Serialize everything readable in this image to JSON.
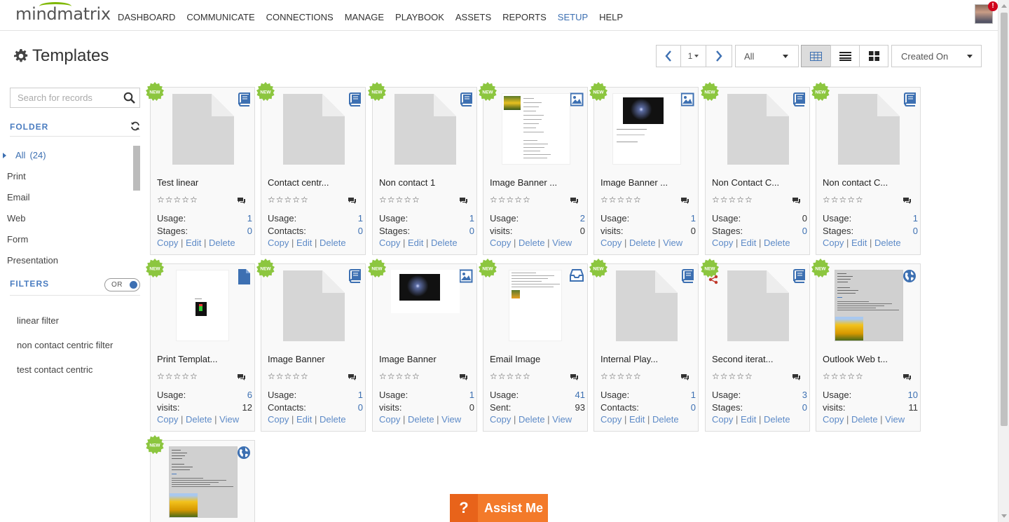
{
  "app": {
    "logo": "mindmatrix"
  },
  "nav": {
    "items": [
      "DASHBOARD",
      "COMMUNICATE",
      "CONNECTIONS",
      "MANAGE",
      "PLAYBOOK",
      "ASSETS",
      "REPORTS",
      "SETUP",
      "HELP"
    ],
    "active": "SETUP",
    "notification_badge": "!"
  },
  "page": {
    "title": "Templates",
    "title_icon": "gear-icon"
  },
  "toolbar": {
    "page_number": "1",
    "filter_value": "All",
    "sort_value": "Created On",
    "active_view": "grid"
  },
  "sidebar": {
    "search_placeholder": "Search for records",
    "folder_title": "FOLDER",
    "folders": [
      {
        "label": "All",
        "count": "(24)",
        "active": true
      },
      {
        "label": "Print"
      },
      {
        "label": "Email"
      },
      {
        "label": "Web"
      },
      {
        "label": "Form"
      },
      {
        "label": "Presentation"
      }
    ],
    "filters_title": "FILTERS",
    "toggle_label": "OR",
    "filters": [
      "linear filter",
      "non contact centric filter",
      "test contact centric"
    ]
  },
  "cards": [
    {
      "title": "Test linear",
      "icon": "book-icon",
      "thumb": "blank",
      "r1": "Usage:",
      "v1": "1",
      "r2": "Stages:",
      "v2": "0",
      "v2blue": true,
      "actions": [
        "Copy",
        "Edit",
        "Delete"
      ]
    },
    {
      "title": "Contact centr...",
      "icon": "book-icon",
      "thumb": "blank",
      "r1": "Usage:",
      "v1": "1",
      "r2": "Contacts:",
      "v2": "0",
      "v2blue": true,
      "actions": [
        "Copy",
        "Edit",
        "Delete"
      ]
    },
    {
      "title": "Non contact 1",
      "icon": "book-icon",
      "thumb": "blank",
      "r1": "Usage:",
      "v1": "1",
      "r2": "Stages:",
      "v2": "0",
      "v2blue": true,
      "actions": [
        "Copy",
        "Edit",
        "Delete"
      ]
    },
    {
      "title": "Image Banner ...",
      "icon": "image-icon",
      "thumb": "doc-flower",
      "r1": "Usage:",
      "v1": "2",
      "r2": "visits:",
      "v2": "0",
      "v2blue": false,
      "actions": [
        "Copy",
        "Delete",
        "View"
      ]
    },
    {
      "title": "Image Banner ...",
      "icon": "image-icon",
      "thumb": "doc-night",
      "r1": "Usage:",
      "v1": "1",
      "r2": "visits:",
      "v2": "0",
      "v2blue": false,
      "actions": [
        "Copy",
        "Delete",
        "View"
      ]
    },
    {
      "title": "Non Contact C...",
      "icon": "book-icon",
      "thumb": "blank",
      "r1": "Usage:",
      "v1": "0",
      "v1blue": false,
      "r2": "Stages:",
      "v2": "0",
      "v2blue": true,
      "actions": [
        "Copy",
        "Edit",
        "Delete"
      ]
    },
    {
      "title": "Non contact C...",
      "icon": "book-icon",
      "thumb": "blank",
      "r1": "Usage:",
      "v1": "1",
      "r2": "Stages:",
      "v2": "0",
      "v2blue": true,
      "actions": [
        "Copy",
        "Edit",
        "Delete"
      ]
    },
    {
      "title": "Print Templat...",
      "icon": "file-icon",
      "thumb": "print",
      "r1": "Usage:",
      "v1": "6",
      "r2": "visits:",
      "v2": "12",
      "v2blue": false,
      "actions": [
        "Copy",
        "Delete",
        "View"
      ]
    },
    {
      "title": "Image Banner",
      "icon": "book-icon",
      "thumb": "blank",
      "r1": "Usage:",
      "v1": "1",
      "r2": "Contacts:",
      "v2": "0",
      "v2blue": true,
      "actions": [
        "Copy",
        "Edit",
        "Delete"
      ]
    },
    {
      "title": "Image Banner",
      "icon": "image-icon",
      "thumb": "night",
      "r1": "Usage:",
      "v1": "1",
      "r2": "visits:",
      "v2": "0",
      "v2blue": false,
      "actions": [
        "Copy",
        "Delete",
        "View"
      ]
    },
    {
      "title": "Email Image",
      "icon": "inbox-icon",
      "thumb": "email",
      "r1": "Usage:",
      "v1": "41",
      "r2": "Sent:",
      "v2": "93",
      "v2blue": false,
      "actions": [
        "Copy",
        "Delete",
        "View"
      ]
    },
    {
      "title": "Internal Play...",
      "icon": "book-icon",
      "thumb": "blank",
      "r1": "Usage:",
      "v1": "1",
      "r2": "Contacts:",
      "v2": "0",
      "v2blue": true,
      "actions": [
        "Copy",
        "Edit",
        "Delete"
      ]
    },
    {
      "title": "Second iterat...",
      "icon": "book-icon",
      "thumb": "blank",
      "share": true,
      "r1": "Usage:",
      "v1": "3",
      "r2": "Stages:",
      "v2": "0",
      "v2blue": true,
      "actions": [
        "Copy",
        "Edit",
        "Delete"
      ]
    },
    {
      "title": "Outlook Web t...",
      "icon": "globe-icon",
      "thumb": "outlook",
      "r1": "Usage:",
      "v1": "10",
      "r2": "visits:",
      "v2": "11",
      "v2blue": false,
      "actions": [
        "Copy",
        "Delete",
        "View"
      ]
    },
    {
      "title": "",
      "icon": "globe-icon",
      "thumb": "outlook",
      "partial": true
    }
  ],
  "badge_text": "NEW",
  "assist": {
    "q": "?",
    "label": "Assist Me"
  },
  "colors": {
    "accent": "#3d70b2",
    "link": "#5d8ac7",
    "badge": "#8cc63f",
    "assist": "#f37a2a"
  }
}
